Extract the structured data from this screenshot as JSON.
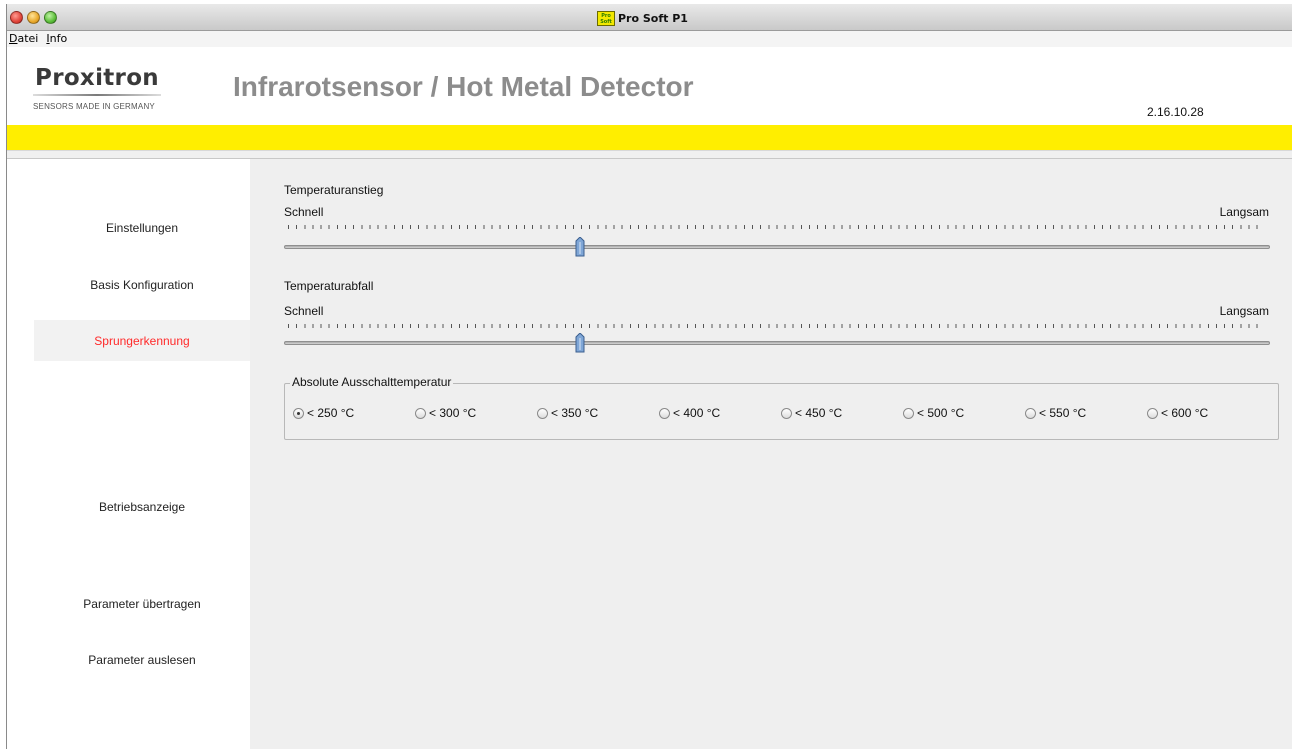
{
  "window": {
    "title": "Pro Soft P1",
    "app_icon_text_top": "Pro",
    "app_icon_text_bottom": "Soft"
  },
  "menu": [
    {
      "mnemonic": "D",
      "rest": "atei"
    },
    {
      "mnemonic": "I",
      "rest": "nfo"
    }
  ],
  "header": {
    "logo_name": "Proxitron",
    "logo_tagline": "SENSORS MADE IN GERMANY",
    "title": "Infrarotsensor / Hot Metal Detector",
    "version": "2.16.10.28"
  },
  "colors": {
    "accent_yellow": "#ffee00",
    "active_nav_text": "#ff2a2a",
    "title_gray": "#8c8c8c"
  },
  "sidebar": {
    "items": [
      {
        "label": "Einstellungen",
        "active": false
      },
      {
        "label": "Basis Konfiguration",
        "active": false
      },
      {
        "label": "Sprungerkennung",
        "active": true
      },
      {
        "label": "Betriebsanzeige",
        "active": false
      },
      {
        "label": "Parameter übertragen",
        "active": false
      },
      {
        "label": "Parameter auslesen",
        "active": false
      }
    ]
  },
  "sliders": [
    {
      "title": "Temperaturanstieg",
      "min_label": "Schnell",
      "max_label": "Langsam",
      "position_fraction": 0.3
    },
    {
      "title": "Temperaturabfall",
      "min_label": "Schnell",
      "max_label": "Langsam",
      "position_fraction": 0.3
    }
  ],
  "cutoff": {
    "legend": "Absolute Ausschalttemperatur",
    "options": [
      "< 250 °C",
      "< 300 °C",
      "< 350 °C",
      "< 400 °C",
      "< 450 °C",
      "< 500 °C",
      "< 550 °C",
      "< 600 °C"
    ],
    "selected": "< 250 °C"
  }
}
